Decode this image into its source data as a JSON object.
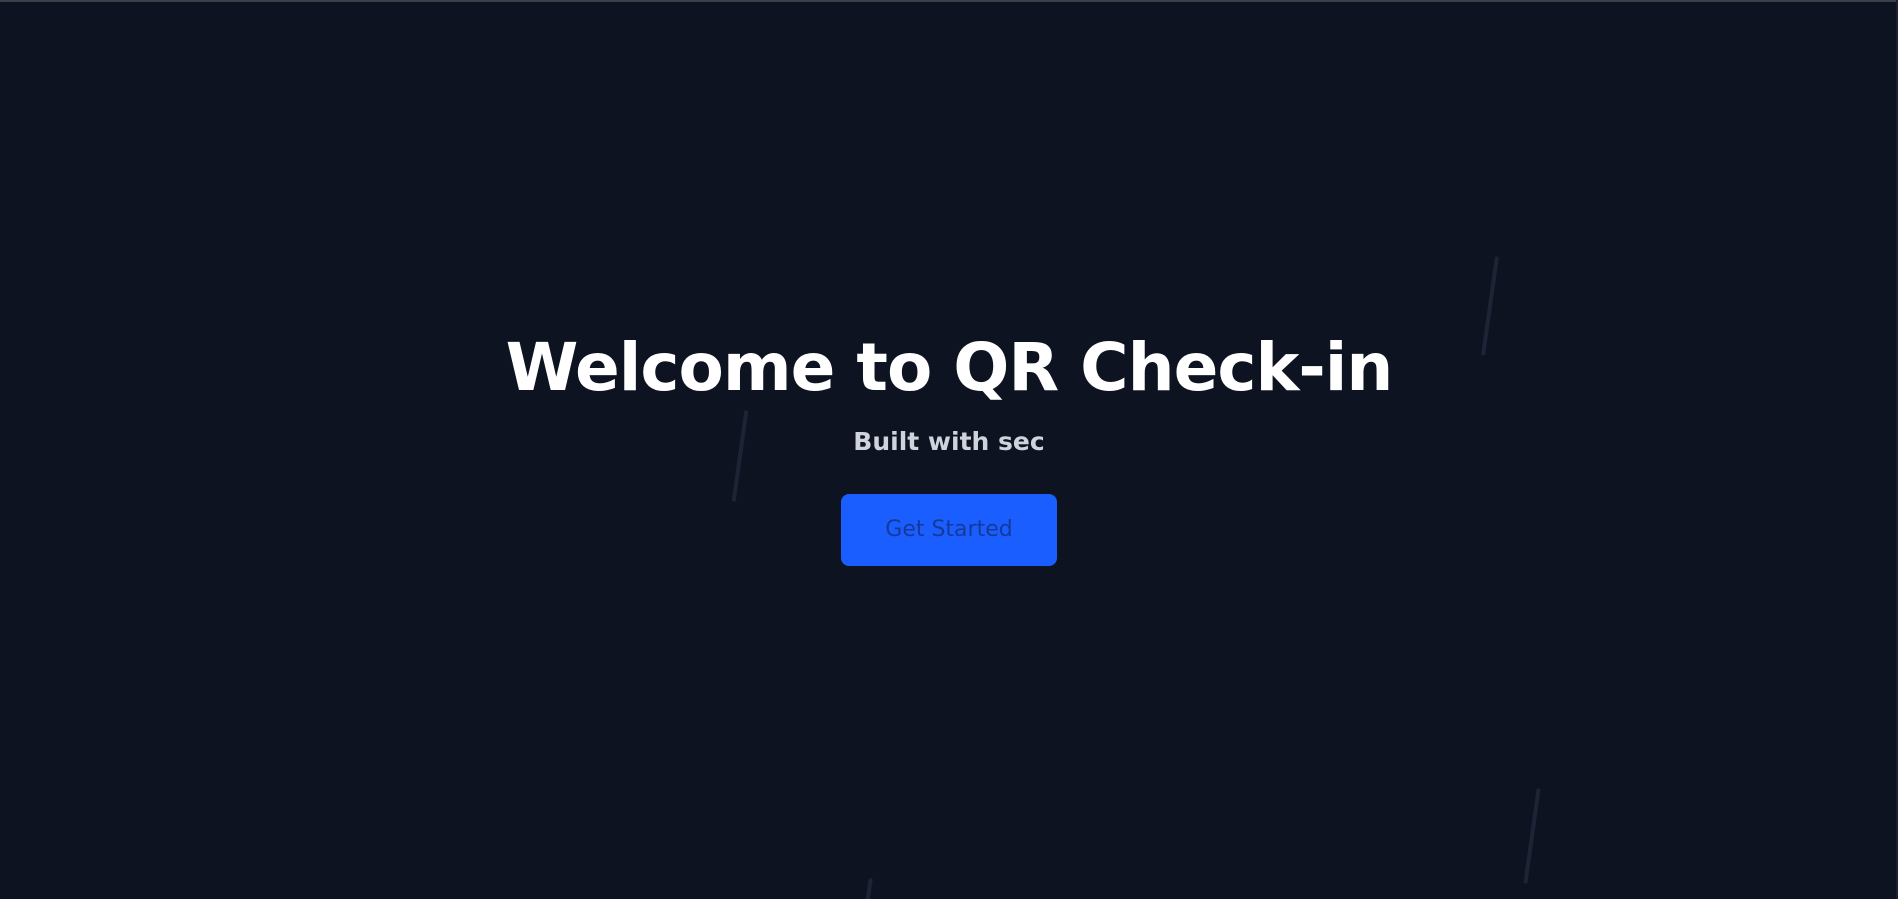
{
  "hero": {
    "title": "Welcome to QR Check-in",
    "subtitle": "Built with sec",
    "cta_label": "Get Started"
  },
  "colors": {
    "background": "#0d1321",
    "accent": "#1a5eff",
    "title": "#ffffff",
    "subtitle": "#cfd3dc",
    "button_text": "#153a9a"
  }
}
